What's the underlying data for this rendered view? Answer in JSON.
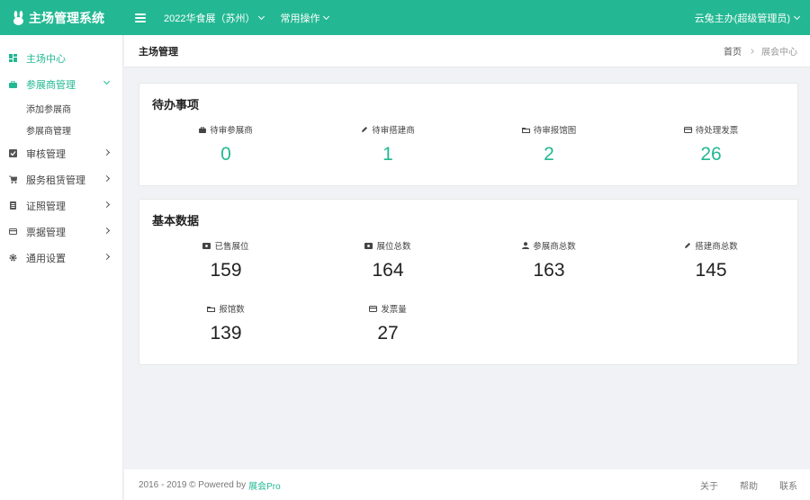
{
  "app": {
    "title": "主场管理系统"
  },
  "topbar": {
    "exhibition": "2022华食展（苏州）",
    "common_ops": "常用操作",
    "user": "云兔主办(超级管理员)"
  },
  "sidebar": {
    "items": [
      {
        "label": "主场中心"
      },
      {
        "label": "参展商管理",
        "children": [
          {
            "label": "添加参展商"
          },
          {
            "label": "参展商管理"
          }
        ]
      },
      {
        "label": "审核管理"
      },
      {
        "label": "服务租赁管理"
      },
      {
        "label": "证照管理"
      },
      {
        "label": "票据管理"
      },
      {
        "label": "通用设置"
      }
    ]
  },
  "header": {
    "title": "主场管理",
    "breadcrumb": [
      "首页",
      "展会中心"
    ]
  },
  "todo": {
    "title": "待办事项",
    "stats": [
      {
        "label": "待审参展商",
        "value": "0",
        "icon": "briefcase-icon"
      },
      {
        "label": "待审搭建商",
        "value": "1",
        "icon": "pencil-icon"
      },
      {
        "label": "待审报馆图",
        "value": "2",
        "icon": "folder-icon"
      },
      {
        "label": "待处理发票",
        "value": "26",
        "icon": "card-icon"
      }
    ]
  },
  "basic": {
    "title": "基本数据",
    "stats": [
      {
        "label": "已售展位",
        "value": "159",
        "icon": "ticket-icon"
      },
      {
        "label": "展位总数",
        "value": "164",
        "icon": "ticket-icon"
      },
      {
        "label": "参展商总数",
        "value": "163",
        "icon": "user-icon"
      },
      {
        "label": "搭建商总数",
        "value": "145",
        "icon": "pencil-icon"
      },
      {
        "label": "报馆数",
        "value": "139",
        "icon": "folder-icon"
      },
      {
        "label": "发票量",
        "value": "27",
        "icon": "card-icon"
      }
    ]
  },
  "footer": {
    "copyright": "2016 - 2019 © Powered by",
    "brand": "展会Pro",
    "links": [
      "关于",
      "帮助",
      "联系"
    ]
  },
  "colors": {
    "accent": "#23b893",
    "background": "#f0f2f5"
  }
}
